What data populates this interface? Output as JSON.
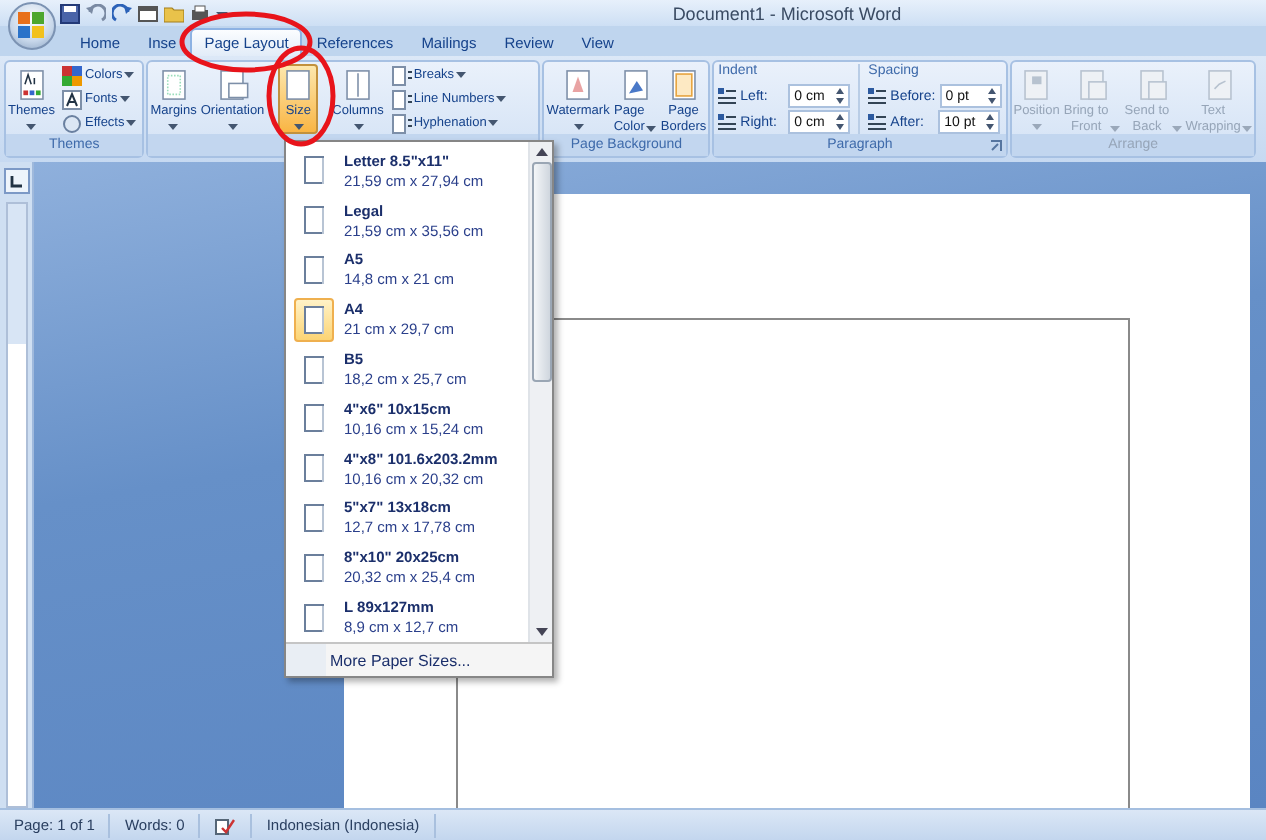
{
  "window": {
    "title": "Document1 - Microsoft Word"
  },
  "tabs": [
    {
      "label": "Home",
      "selected": false
    },
    {
      "label": "Inse",
      "selected": false
    },
    {
      "label": "Page Layout",
      "selected": true
    },
    {
      "label": "References",
      "selected": false
    },
    {
      "label": "Mailings",
      "selected": false
    },
    {
      "label": "Review",
      "selected": false
    },
    {
      "label": "View",
      "selected": false
    }
  ],
  "ribbon": {
    "groups": [
      {
        "label": "Themes",
        "disabled": false,
        "buttons": [
          {
            "kind": "large",
            "label": "Themes",
            "dropdown": true,
            "pressed": false
          },
          {
            "kind": "small",
            "label": "Colors",
            "dropdown": true
          },
          {
            "kind": "small",
            "label": "Fonts",
            "dropdown": true
          },
          {
            "kind": "small",
            "label": "Effects",
            "dropdown": true
          }
        ]
      },
      {
        "disabled": false,
        "buttons": [
          {
            "kind": "large",
            "label": "Margins",
            "dropdown": true,
            "pressed": false
          },
          {
            "kind": "large",
            "label": "Orientation",
            "dropdown": true,
            "pressed": false
          },
          {
            "kind": "large",
            "label": "Size",
            "dropdown": true,
            "pressed": true
          },
          {
            "kind": "large",
            "label": "Columns",
            "dropdown": true,
            "pressed": false
          },
          {
            "kind": "small",
            "label": "Breaks",
            "dropdown": true
          },
          {
            "kind": "small",
            "label": "Line Numbers",
            "dropdown": true
          },
          {
            "kind": "small",
            "label": "Hyphenation",
            "dropdown": true
          }
        ]
      },
      {
        "label": "Page Background",
        "disabled": false,
        "buttons": [
          {
            "kind": "large",
            "label": "Watermark",
            "dropdown": true,
            "pressed": false
          },
          {
            "kind": "large",
            "label": "Page\nColor",
            "dropdown": true,
            "pressed": false
          },
          {
            "kind": "large",
            "label": "Page\nBorders",
            "dropdown": false,
            "pressed": false
          }
        ]
      },
      {
        "label": "Paragraph",
        "disabled": false,
        "sections": [
          {
            "heading": "Indent",
            "fields": [
              {
                "label": "Left:",
                "value": "0 cm"
              },
              {
                "label": "Right:",
                "value": "0 cm"
              }
            ]
          },
          {
            "heading": "Spacing",
            "fields": [
              {
                "label": "Before:",
                "value": "0 pt"
              },
              {
                "label": "After:",
                "value": "10 pt"
              }
            ]
          }
        ]
      },
      {
        "label": "Arrange",
        "disabled": true,
        "buttons": [
          {
            "kind": "large",
            "label": "Position",
            "dropdown": true,
            "pressed": false
          },
          {
            "kind": "large",
            "label": "Bring to\nFront",
            "dropdown": true,
            "pressed": false
          },
          {
            "kind": "large",
            "label": "Send to\nBack",
            "dropdown": true,
            "pressed": false
          },
          {
            "kind": "large",
            "label": "Text\nWrapping",
            "dropdown": true,
            "pressed": false
          }
        ]
      }
    ]
  },
  "size_menu": {
    "items": [
      {
        "name": "Letter 8.5\"x11\"",
        "dims": "21,59 cm x 27,94 cm",
        "selected": false
      },
      {
        "name": "Legal",
        "dims": "21,59 cm x 35,56 cm",
        "selected": false
      },
      {
        "name": "A5",
        "dims": "14,8 cm x 21 cm",
        "selected": false
      },
      {
        "name": "A4",
        "dims": "21 cm x 29,7 cm",
        "selected": true
      },
      {
        "name": "B5",
        "dims": "18,2 cm x 25,7 cm",
        "selected": false
      },
      {
        "name": "4\"x6\" 10x15cm",
        "dims": "10,16 cm x 15,24 cm",
        "selected": false
      },
      {
        "name": "4\"x8\" 101.6x203.2mm",
        "dims": "10,16 cm x 20,32 cm",
        "selected": false
      },
      {
        "name": "5\"x7\" 13x18cm",
        "dims": "12,7 cm x 17,78 cm",
        "selected": false
      },
      {
        "name": "8\"x10\" 20x25cm",
        "dims": "20,32 cm x 25,4 cm",
        "selected": false
      },
      {
        "name": "L 89x127mm",
        "dims": "8,9 cm x 12,7 cm",
        "selected": false
      }
    ],
    "footer": "More Paper Sizes..."
  },
  "status_bar": {
    "page": "Page: 1 of 1",
    "words": "Words: 0",
    "language": "Indonesian (Indonesia)"
  }
}
